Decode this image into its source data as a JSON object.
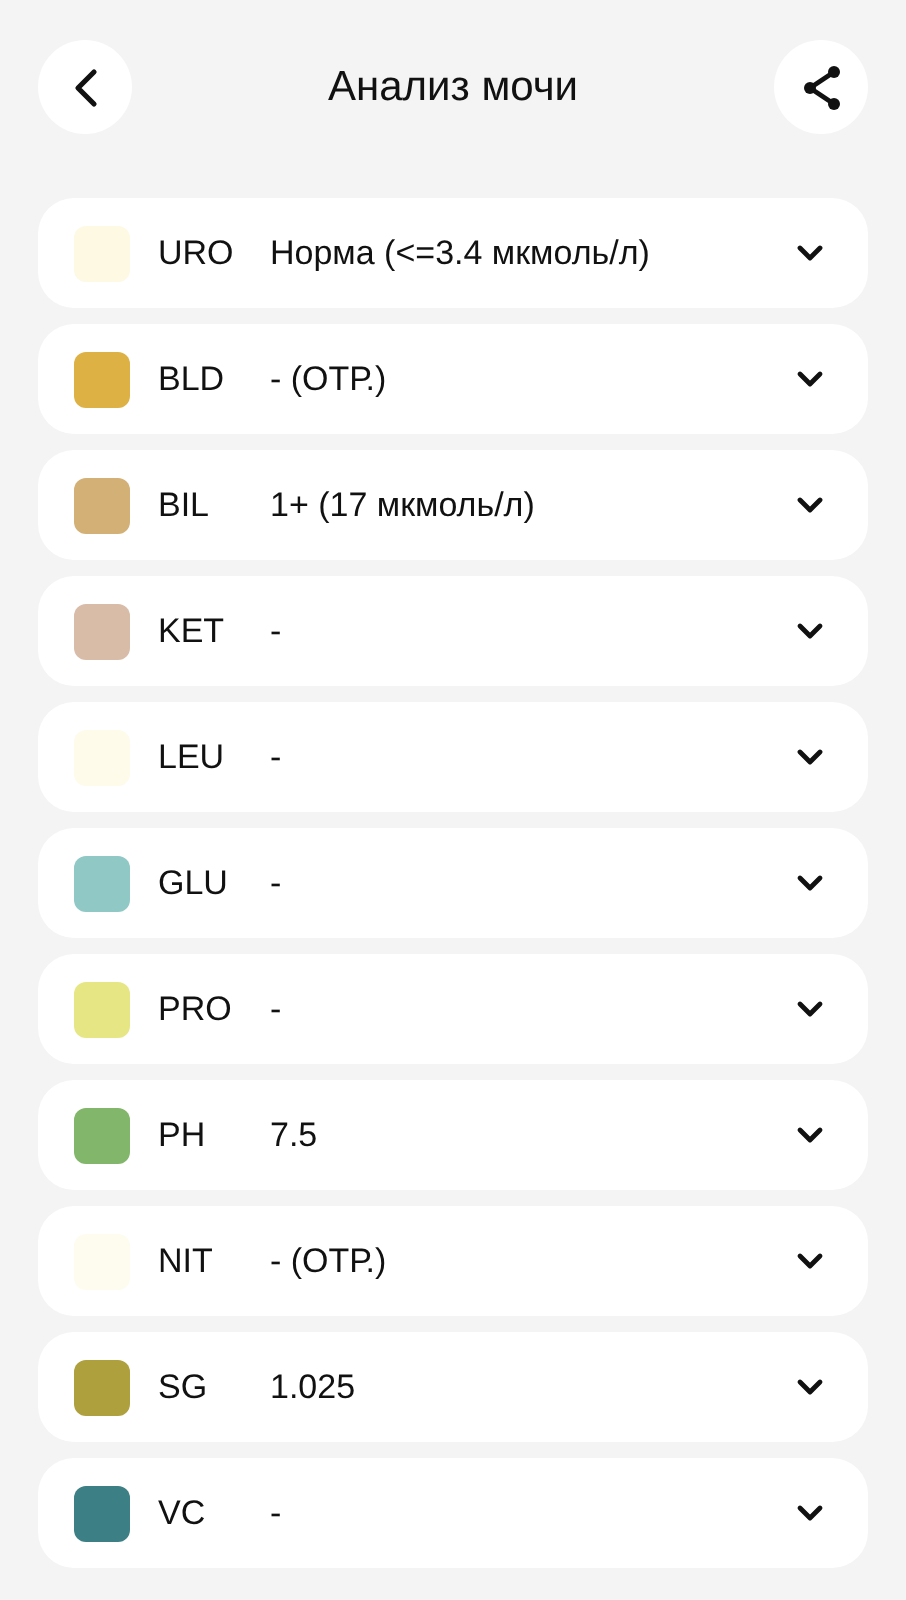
{
  "header": {
    "title": "Анализ мочи"
  },
  "results": [
    {
      "code": "URO",
      "value": "Норма (<=3.4 мкмоль/л)",
      "color": "#fdf9e3",
      "expanded": false
    },
    {
      "code": "BLD",
      "value": "- (ОТР.)",
      "color": "#deb144",
      "expanded": false
    },
    {
      "code": "BIL",
      "value": "1+ (17 мкмоль/л)",
      "color": "#d3b076",
      "expanded": false
    },
    {
      "code": "KET",
      "value": "-",
      "color": "#d8bca8",
      "expanded": false
    },
    {
      "code": "LEU",
      "value": "-",
      "color": "#fefbea",
      "expanded": false
    },
    {
      "code": "GLU",
      "value": "-",
      "color": "#8fc8c5",
      "expanded": false
    },
    {
      "code": "PRO",
      "value": "-",
      "color": "#e6e784",
      "expanded": false
    },
    {
      "code": "PH",
      "value": "7.5",
      "color": "#82b66a",
      "expanded": false
    },
    {
      "code": "NIT",
      "value": "- (ОТР.)",
      "color": "#fefcee",
      "expanded": false
    },
    {
      "code": "SG",
      "value": "1.025",
      "color": "#afa03e",
      "expanded": false
    },
    {
      "code": "VC",
      "value": "-",
      "color": "#3c7f84",
      "expanded": false
    }
  ]
}
